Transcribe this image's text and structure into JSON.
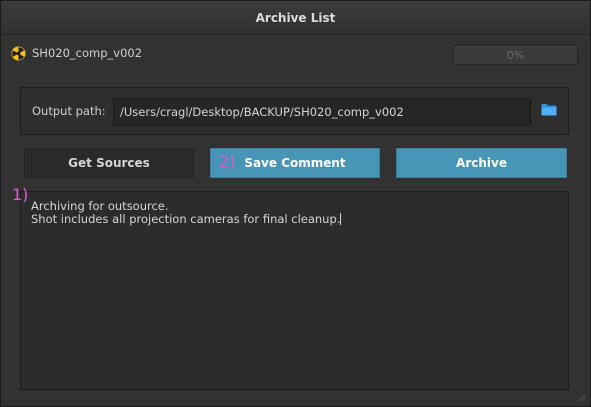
{
  "window": {
    "title": "Archive List"
  },
  "comp": {
    "icon": "nuke-icon",
    "name": "SH020_comp_v002"
  },
  "progress": {
    "value": 0,
    "label": "0%"
  },
  "output": {
    "label": "Output path:",
    "value": "/Users/cragl/Desktop/BACKUP/SH020_comp_v002",
    "browse_icon": "folder-icon"
  },
  "buttons": {
    "get_sources": "Get Sources",
    "save_comment": "Save Comment",
    "archive": "Archive"
  },
  "comment": {
    "lines": [
      "Archiving for outsource.",
      "Shot includes all projection cameras for final cleanup."
    ]
  },
  "annotations": {
    "one": "1)",
    "two": "2)"
  },
  "colors": {
    "accent": "#4796b8",
    "annotation": "#e05ad8",
    "background": "#323232"
  }
}
